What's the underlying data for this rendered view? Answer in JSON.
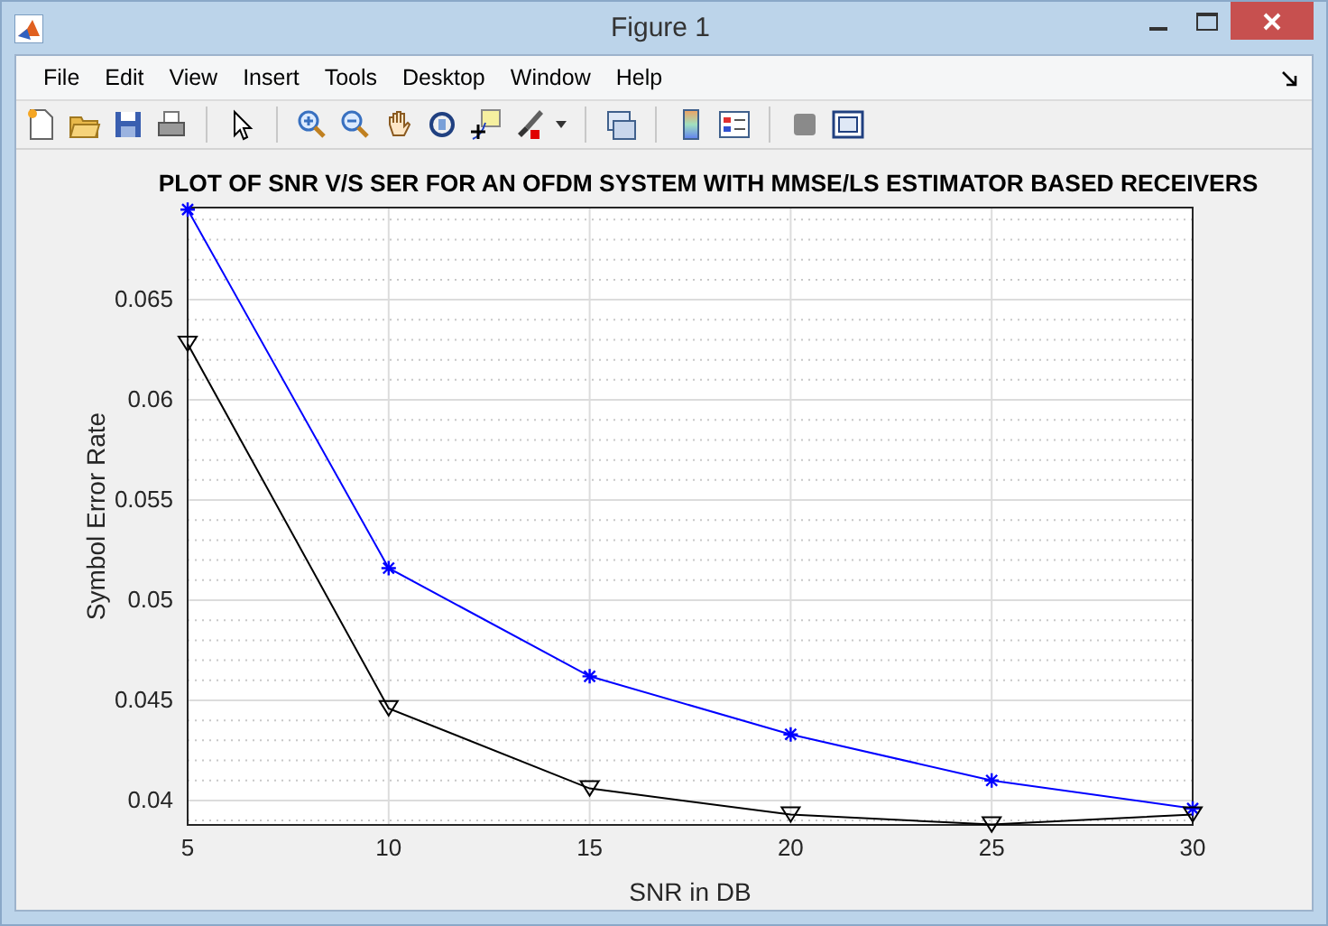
{
  "window": {
    "title": "Figure 1"
  },
  "menu": [
    "File",
    "Edit",
    "View",
    "Insert",
    "Tools",
    "Desktop",
    "Window",
    "Help"
  ],
  "toolbar": [
    {
      "kind": "new"
    },
    {
      "kind": "open"
    },
    {
      "kind": "save"
    },
    {
      "kind": "print"
    },
    {
      "kind": "sep"
    },
    {
      "kind": "pointer"
    },
    {
      "kind": "sep"
    },
    {
      "kind": "zoomin"
    },
    {
      "kind": "zoomout"
    },
    {
      "kind": "pan"
    },
    {
      "kind": "rotate"
    },
    {
      "kind": "cursor"
    },
    {
      "kind": "brush"
    },
    {
      "kind": "caret"
    },
    {
      "kind": "sep"
    },
    {
      "kind": "link"
    },
    {
      "kind": "sep"
    },
    {
      "kind": "colorbar"
    },
    {
      "kind": "legend"
    },
    {
      "kind": "sep"
    },
    {
      "kind": "hide"
    },
    {
      "kind": "show"
    }
  ],
  "figure": {
    "chart_data": {
      "type": "line",
      "grid": true,
      "title": "PLOT OF SNR V/S SER FOR AN OFDM SYSTEM WITH MMSE/LS ESTIMATOR BASED RECEIVERS",
      "xlabel": "SNR in DB",
      "ylabel": "Symbol Error Rate",
      "x": [
        5,
        10,
        15,
        20,
        25,
        30
      ],
      "xlim": [
        5,
        30
      ],
      "ylim": [
        0.03878,
        0.0696
      ],
      "xticks": [
        5,
        10,
        15,
        20,
        25,
        30
      ],
      "yticks": [
        {
          "value": 0.04,
          "label": "0.04"
        },
        {
          "value": 0.045,
          "label": "0.045"
        },
        {
          "value": 0.05,
          "label": "0.05"
        },
        {
          "value": 0.055,
          "label": "0.055"
        },
        {
          "value": 0.06,
          "label": "0.06"
        },
        {
          "value": 0.065,
          "label": "0.065"
        }
      ],
      "series": [
        {
          "color": "#0000ff",
          "marker": "cross",
          "values": [
            0.0695,
            0.0516,
            0.0462,
            0.0433,
            0.041,
            0.0396
          ]
        },
        {
          "color": "#000000",
          "marker": "triangle",
          "values": [
            0.0628,
            0.0446,
            0.0406,
            0.0393,
            0.0388,
            0.0393
          ]
        }
      ]
    }
  }
}
